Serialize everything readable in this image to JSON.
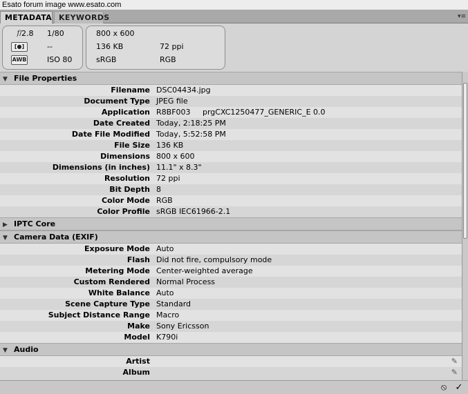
{
  "window_title": "Esato forum image www.esato.com",
  "tabs": {
    "metadata": "METADATA",
    "keywords": "KEYWORDS",
    "menu_icon": "panel-menu-icon"
  },
  "summary": {
    "aperture": "2.8",
    "shutter": "1/80",
    "metering": "--",
    "iso": "ISO 80",
    "dimensions": "800 x 600",
    "file_size": "136 KB",
    "resolution": "72 ppi",
    "color_profile": "sRGB",
    "color_mode": "RGB"
  },
  "sections": {
    "file_properties": {
      "title": "File Properties",
      "rows": [
        {
          "label": "Filename",
          "value": "DSC04434.jpg"
        },
        {
          "label": "Document Type",
          "value": "JPEG file"
        },
        {
          "label": "Application",
          "value": "R8BF003     prgCXC1250477_GENERIC_E 0.0"
        },
        {
          "label": "Date Created",
          "value": "Today, 2:18:25 PM"
        },
        {
          "label": "Date File Modified",
          "value": "Today, 5:52:58 PM"
        },
        {
          "label": "File Size",
          "value": "136 KB"
        },
        {
          "label": "Dimensions",
          "value": "800 x 600"
        },
        {
          "label": "Dimensions (in inches)",
          "value": "11.1\" x 8.3\""
        },
        {
          "label": "Resolution",
          "value": "72 ppi"
        },
        {
          "label": "Bit Depth",
          "value": "8"
        },
        {
          "label": "Color Mode",
          "value": "RGB"
        },
        {
          "label": "Color Profile",
          "value": "sRGB IEC61966-2.1"
        }
      ]
    },
    "iptc": {
      "title": "IPTC Core"
    },
    "camera": {
      "title": "Camera Data (EXIF)",
      "rows": [
        {
          "label": "Exposure Mode",
          "value": "Auto"
        },
        {
          "label": "Flash",
          "value": "Did not fire, compulsory mode"
        },
        {
          "label": "Metering Mode",
          "value": "Center-weighted average"
        },
        {
          "label": "Custom Rendered",
          "value": "Normal Process"
        },
        {
          "label": "White Balance",
          "value": "Auto"
        },
        {
          "label": "Scene Capture Type",
          "value": "Standard"
        },
        {
          "label": "Subject Distance Range",
          "value": "Macro"
        },
        {
          "label": "Make",
          "value": "Sony Ericsson"
        },
        {
          "label": "Model",
          "value": "K790i"
        }
      ]
    },
    "audio": {
      "title": "Audio",
      "rows": [
        {
          "label": "Artist",
          "value": ""
        },
        {
          "label": "Album",
          "value": ""
        }
      ]
    }
  },
  "bottom": {
    "cancel_icon": "cancel-icon",
    "apply_icon": "checkmark-icon"
  }
}
